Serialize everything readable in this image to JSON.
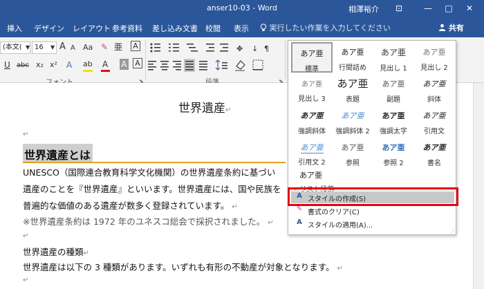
{
  "titlebar": {
    "doc_title": "anser10-03  -  Word",
    "user": "相澤裕介",
    "buttons": [
      "⊡",
      "—",
      "□",
      "✕"
    ]
  },
  "tabs": [
    "挿入",
    "デザイン",
    "レイアウト",
    "参考資料",
    "差し込み文書",
    "校閲",
    "表示"
  ],
  "tellme": {
    "icon": "lightbulb-icon",
    "text": "実行したい作業を入力してください"
  },
  "share": {
    "icon": "person-icon",
    "label": "共有"
  },
  "ribbon": {
    "font_name": "(本文(",
    "font_size": "16",
    "font_group_label": "フォント",
    "paragraph_group_label": "段落",
    "grow": "A",
    "shrink": "A",
    "case": "Aa",
    "clear": "✎",
    "phonetic": "亜",
    "border": "A",
    "underline": "U",
    "strike": "abc",
    "sub": "x₂",
    "sup": "x²",
    "effects": "A",
    "highlight": "ab",
    "fontcolor": "A",
    "shade": "A",
    "charborder": "A",
    "highlight_color": "#f4e100",
    "fontcolor_color": "#e01010"
  },
  "document": {
    "title": "世界遺産",
    "heading": "世界遺産とは",
    "lines": [
      "UNESCO（国際連合教育科学文化機関）の世界遺産条約に基づい",
      "遺産のことを『世界遺産』といいます。世界遺産には、国や民族を",
      "普遍的な価値のある遺産が数多く登録されています。",
      "※世界遺産条約は 1972 年のユネスコ総会で採択されました。",
      "世界遺産の種類",
      "世界遺産は以下の 3 種類があります。いずれも有形の不動産が対象となります。"
    ],
    "para_mark": "↵"
  },
  "gallery": {
    "styles": [
      {
        "preview": "あア亜",
        "name": "標準"
      },
      {
        "preview": "あア亜",
        "name": "行間詰め"
      },
      {
        "preview": "あア亜",
        "name": "見出し 1"
      },
      {
        "preview": "あア亜",
        "name": "見出し 2"
      },
      {
        "preview": "あア亜",
        "name": "見出し 3"
      },
      {
        "preview": "あア亜",
        "name": "表題"
      },
      {
        "preview": "あア亜",
        "name": "副題"
      },
      {
        "preview": "あア亜",
        "name": "斜体"
      },
      {
        "preview": "あア亜",
        "name": "強調斜体"
      },
      {
        "preview": "あア亜",
        "name": "強調斜体 2"
      },
      {
        "preview": "あア亜",
        "name": "強調太字"
      },
      {
        "preview": "あア亜",
        "name": "引用文"
      },
      {
        "preview": "あア亜",
        "name": "引用文 2"
      },
      {
        "preview": "あア亜",
        "name": "参照"
      },
      {
        "preview": "あア亜",
        "name": "参照 2"
      },
      {
        "preview": "あア亜",
        "name": "書名"
      },
      {
        "preview": "あア亜",
        "name": "リスト段落"
      }
    ],
    "commands": [
      {
        "icon": "create-style-icon",
        "label": "スタイルの作成(S)"
      },
      {
        "icon": "clear-format-icon",
        "label": "書式のクリア(C)"
      },
      {
        "icon": "apply-styles-icon",
        "label": "スタイルの適用(A)..."
      }
    ]
  },
  "colors": {
    "word_blue": "#2b579a",
    "highlight_box": "#e60012",
    "heading_rule": "#e8a020"
  }
}
